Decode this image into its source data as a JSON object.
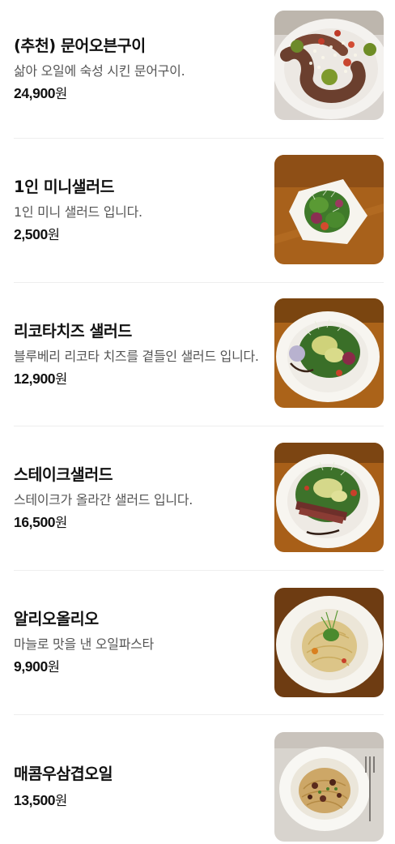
{
  "menu": {
    "items": [
      {
        "name": "(추천) 문어오븐구이",
        "description": "삶아 오일에 숙성 시킨 문어구이.",
        "price": "24,900",
        "currency": "원",
        "image": "octopus-dish"
      },
      {
        "name": "1인 미니샐러드",
        "description": "1인 미니 샐러드 입니다.",
        "price": "2,500",
        "currency": "원",
        "image": "mini-salad"
      },
      {
        "name": "리코타치즈 샐러드",
        "description": "블루베리 리코타 치즈를 곁들인 샐러드 입니다.",
        "price": "12,900",
        "currency": "원",
        "image": "ricotta-salad"
      },
      {
        "name": "스테이크샐러드",
        "description": "스테이크가 올라간 샐러드 입니다.",
        "price": "16,500",
        "currency": "원",
        "image": "steak-salad"
      },
      {
        "name": "알리오올리오",
        "description": "마늘로 맛을 낸 오일파스타",
        "price": "9,900",
        "currency": "원",
        "image": "aglio-olio-pasta"
      },
      {
        "name": "매콤우삼겹오일",
        "description": "",
        "price": "13,500",
        "currency": "원",
        "image": "spicy-beef-oil-pasta"
      }
    ]
  },
  "colors": {
    "name_text": "#111111",
    "desc_text": "#555555",
    "divider": "#eeeeee",
    "table_wood": "#b5701e",
    "plate_white": "#f7f5f0"
  }
}
